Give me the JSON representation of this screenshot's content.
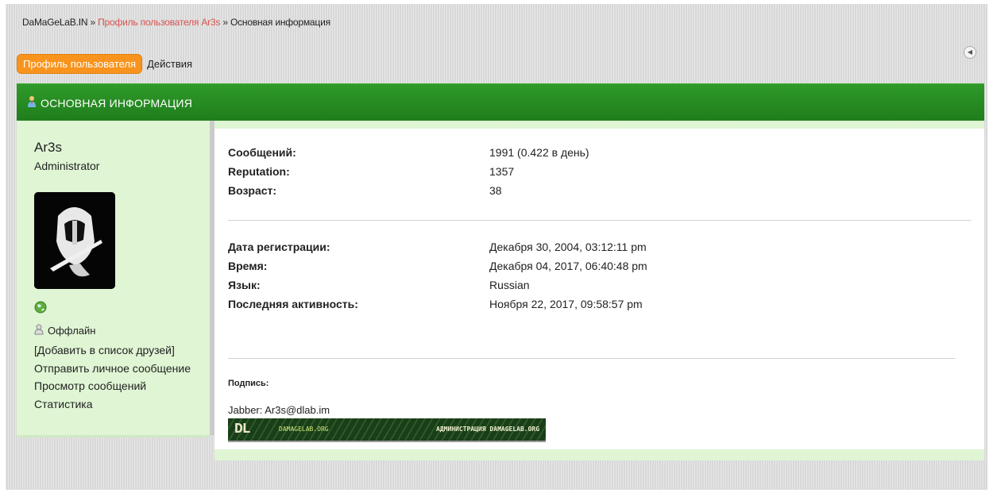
{
  "breadcrumb": {
    "site": "DaMaGeLaB.IN",
    "sep1": "»",
    "profile_link": "Профиль пользователя Ar3s",
    "sep2": "»",
    "current": "Основная информация"
  },
  "tabs": [
    {
      "label": "Профиль пользователя",
      "active": true
    },
    {
      "label": "Действия",
      "active": false
    }
  ],
  "panel_title": "ОСНОВНАЯ ИНФОРМАЦИЯ",
  "user": {
    "name": "Ar3s",
    "role": "Administrator",
    "status": "Оффлайн",
    "links": [
      "[Добавить в список друзей]",
      "Отправить личное сообщение",
      "Просмотр сообщений",
      "Статистика"
    ]
  },
  "stats": [
    {
      "label": "Сообщений:",
      "value": "1991 (0.422 в день)"
    },
    {
      "label": "Reputation:",
      "value": "1357"
    },
    {
      "label": "Возраст:",
      "value": "38"
    }
  ],
  "details": [
    {
      "label": "Дата регистрации:",
      "value": "Декабря 30, 2004, 03:12:11 pm"
    },
    {
      "label": "Время:",
      "value": "Декабря 04, 2017, 06:40:48 pm"
    },
    {
      "label": "Язык:",
      "value": "Russian"
    },
    {
      "label": "Последняя активность:",
      "value": "Ноября 22, 2017, 09:58:57 pm"
    }
  ],
  "signature": {
    "label": "Подпись:",
    "text": "Jabber: Ar3s@dlab.im",
    "banner_logo": "DL",
    "banner_site": "DAMAGELAB.ORG",
    "banner_admin": "АДМИНИСТРАЦИЯ DAMAGELAB.ORG"
  },
  "colors": {
    "accent_tab": "#f8941d",
    "title_bar": "#268a22",
    "panel_bg": "#dff5d4",
    "link": "#d9534f"
  }
}
